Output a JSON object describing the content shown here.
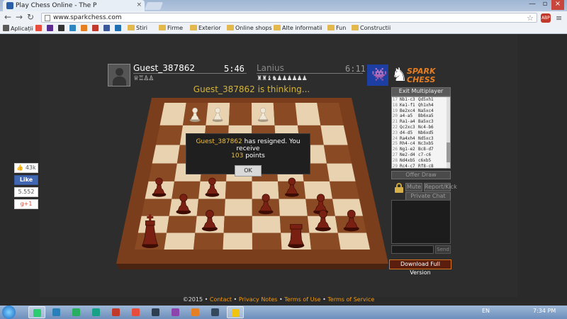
{
  "browser": {
    "tab_title": "Play Chess Online - The P",
    "tab_close": "×",
    "url": "www.sparkchess.com",
    "bookmarks": [
      {
        "label": "Aplicații",
        "color": "#5a5a5a"
      },
      {
        "label": "",
        "color": "#e74c3c"
      },
      {
        "label": "",
        "color": "#5c2d91"
      },
      {
        "label": "",
        "color": "#333"
      },
      {
        "label": "",
        "color": "#2e86c1"
      },
      {
        "label": "",
        "color": "#e67e22"
      },
      {
        "label": "",
        "color": "#c0392b"
      },
      {
        "label": "",
        "color": "#3b5998"
      },
      {
        "label": "",
        "color": "#1f6fb2"
      },
      {
        "label": "Stiri",
        "folder": true
      },
      {
        "label": "Firme",
        "folder": true
      },
      {
        "label": "Exterior",
        "folder": true
      },
      {
        "label": "Online shops",
        "folder": true
      },
      {
        "label": "Alte informatii",
        "folder": true
      },
      {
        "label": "Fun",
        "folder": true
      },
      {
        "label": "Constructii",
        "folder": true
      }
    ],
    "abp_label": "ABP"
  },
  "game": {
    "player1": {
      "name": "Guest_387862",
      "clock": "5:46",
      "captured": "♕♖♙♙"
    },
    "player2": {
      "name": "Lanius",
      "clock": "6:11",
      "captured": "♜♜♝♞♟♟♟♟♟♟"
    },
    "status": "Guest_387862 is thinking...",
    "logo": {
      "line1": "SPARK",
      "line2": "CHESS"
    },
    "buttons": {
      "exit": "Exit Multiplayer",
      "offer_draw": "Offer Draw",
      "mute": "Mute",
      "report": "Report/Kick",
      "chat": "Private Chat",
      "send": "Send",
      "download": "Download Full Version"
    },
    "moves": [
      {
        "n": "17",
        "w": "Nb1-c3",
        "b": "Qd5xh1"
      },
      {
        "n": "18",
        "w": "Ke1-f1",
        "b": "Qh1xh4"
      },
      {
        "n": "19",
        "w": "Be2xc4",
        "b": "Na5xc4"
      },
      {
        "n": "20",
        "w": "a4-a5",
        "b": "Bb6xa5"
      },
      {
        "n": "21",
        "w": "Ra1-a4",
        "b": "Ba5xc3"
      },
      {
        "n": "22",
        "w": "Qc2xc3",
        "b": "Nc4-b6"
      },
      {
        "n": "23",
        "w": "d4-d5",
        "b": "Nb6xd5"
      },
      {
        "n": "24",
        "w": "Ra4xh4",
        "b": "Nd5xc3"
      },
      {
        "n": "25",
        "w": "Rh4-c4",
        "b": "Nc3xb5"
      },
      {
        "n": "26",
        "w": "Ng1-e2",
        "b": "Bc8-d7"
      },
      {
        "n": "27",
        "w": "Ne2-d4",
        "b": "c7-c6"
      },
      {
        "n": "28",
        "w": "Nd4xb5",
        "b": "c6xb5"
      },
      {
        "n": "29",
        "w": "Rc4-c7",
        "b": "Rf8-c8"
      },
      {
        "n": "30",
        "w": "Rc7xc8",
        "b": "Bd7xc8"
      }
    ],
    "dialog": {
      "name": "Guest_387862",
      "text1": "has resigned. You receive",
      "points": "103",
      "text2": "points",
      "ok": "OK"
    }
  },
  "social": {
    "likes": "43k",
    "like": "Like",
    "count": "5.552",
    "gplus": "g+1"
  },
  "footer": {
    "copyright": "©2015 •",
    "contact": "Contact",
    "privacy": "Privacy Notes",
    "terms": "Terms of Use",
    "service": "Terms of Service"
  },
  "taskbar": {
    "lang": "EN",
    "time": "7:34 PM"
  },
  "board": {
    "light": "#e8d2b0",
    "dark": "#8a4a24",
    "frame": "#7a3e1c"
  },
  "pieces": {
    "white": [
      {
        "sq": "b8",
        "type": "pawn"
      },
      {
        "sq": "c8",
        "type": "pawn"
      },
      {
        "sq": "e8",
        "type": "pawn"
      }
    ],
    "black": [
      {
        "sq": "a4",
        "type": "pawn"
      },
      {
        "sq": "b3",
        "type": "pawn"
      },
      {
        "sq": "c4",
        "type": "pawn"
      },
      {
        "sq": "c2",
        "type": "pawn"
      },
      {
        "sq": "e3",
        "type": "pawn"
      },
      {
        "sq": "g3",
        "type": "pawn"
      },
      {
        "sq": "g2",
        "type": "pawn"
      },
      {
        "sq": "h2",
        "type": "pawn"
      },
      {
        "sq": "f4",
        "type": "pawn"
      },
      {
        "sq": "a1",
        "type": "king"
      },
      {
        "sq": "f1",
        "type": "rook"
      }
    ]
  }
}
